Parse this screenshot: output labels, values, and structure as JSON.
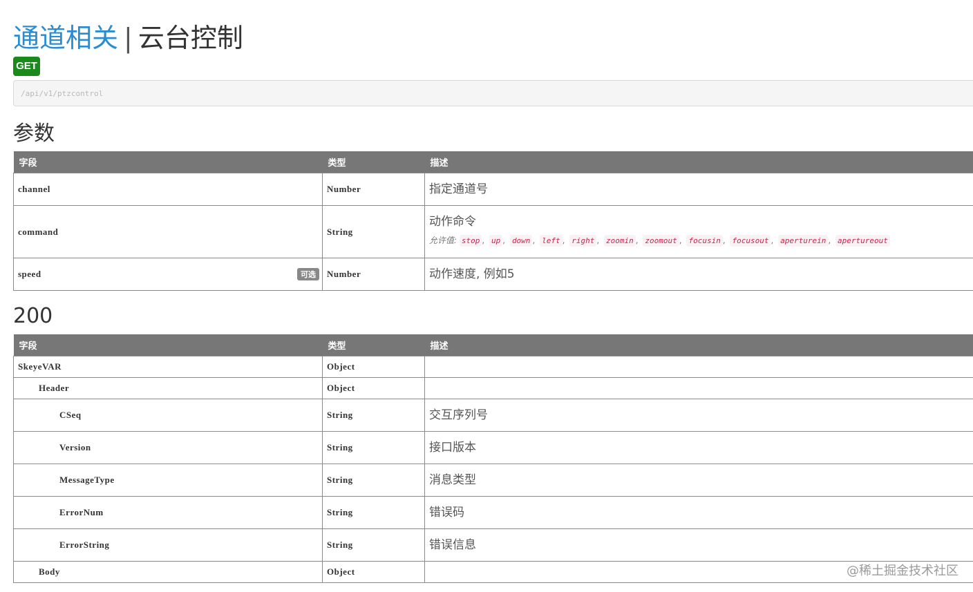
{
  "header": {
    "group": "通道相关",
    "separator": "|",
    "name": "云台控制"
  },
  "method": "GET",
  "url": "/api/v1/ptzcontrol",
  "params_section": {
    "heading": "参数",
    "columns": [
      "字段",
      "类型",
      "描述"
    ],
    "rows": [
      {
        "field": "channel",
        "type": "Number",
        "desc": "指定通道号"
      },
      {
        "field": "command",
        "type": "String",
        "desc": "动作命令",
        "allowed_label": "允许值:",
        "allowed_values": [
          "stop",
          "up",
          "down",
          "left",
          "right",
          "zoomin",
          "zoomout",
          "focusin",
          "focusout",
          "aperturein",
          "apertureout"
        ]
      },
      {
        "field": "speed",
        "type": "Number",
        "desc": "动作速度, 例如5",
        "optional_label": "可选"
      }
    ]
  },
  "response_section": {
    "heading": "200",
    "columns": [
      "字段",
      "类型",
      "描述"
    ],
    "rows": [
      {
        "field": "SkeyeVAR",
        "type": "Object",
        "desc": ""
      },
      {
        "field": "Header",
        "type": "Object",
        "desc": ""
      },
      {
        "field": "CSeq",
        "type": "String",
        "desc": "交互序列号"
      },
      {
        "field": "Version",
        "type": "String",
        "desc": "接口版本"
      },
      {
        "field": "MessageType",
        "type": "String",
        "desc": "消息类型"
      },
      {
        "field": "ErrorNum",
        "type": "String",
        "desc": "错误码"
      },
      {
        "field": "ErrorString",
        "type": "String",
        "desc": "错误信息"
      },
      {
        "field": "Body",
        "type": "Object",
        "desc": ""
      }
    ]
  },
  "watermark": "@稀土掘金技术社区"
}
